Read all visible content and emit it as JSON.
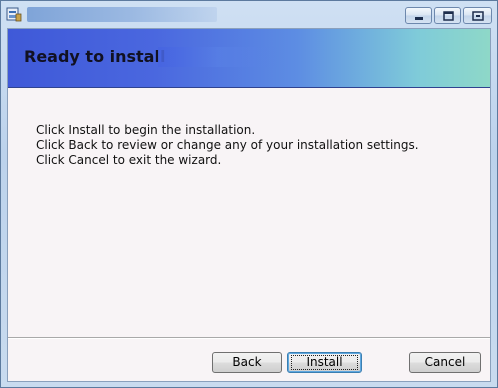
{
  "window": {
    "title": "",
    "controls": {
      "minimize_icon": "minimize-icon",
      "maximize_icon": "maximize-icon",
      "close_icon": "close-icon"
    }
  },
  "banner": {
    "title": "Ready to install",
    "title_suffix_redacted": true
  },
  "body": {
    "lines": [
      "Click Install to begin the installation.",
      "Click Back to review or change any of your installation settings.",
      "Click Cancel to exit the wizard."
    ]
  },
  "buttons": {
    "back": "Back",
    "install": "Install",
    "cancel": "Cancel"
  },
  "colors": {
    "banner_start": "#3f59d8",
    "banner_end": "#8ed8c8",
    "client_bg": "#f8f4f6"
  }
}
